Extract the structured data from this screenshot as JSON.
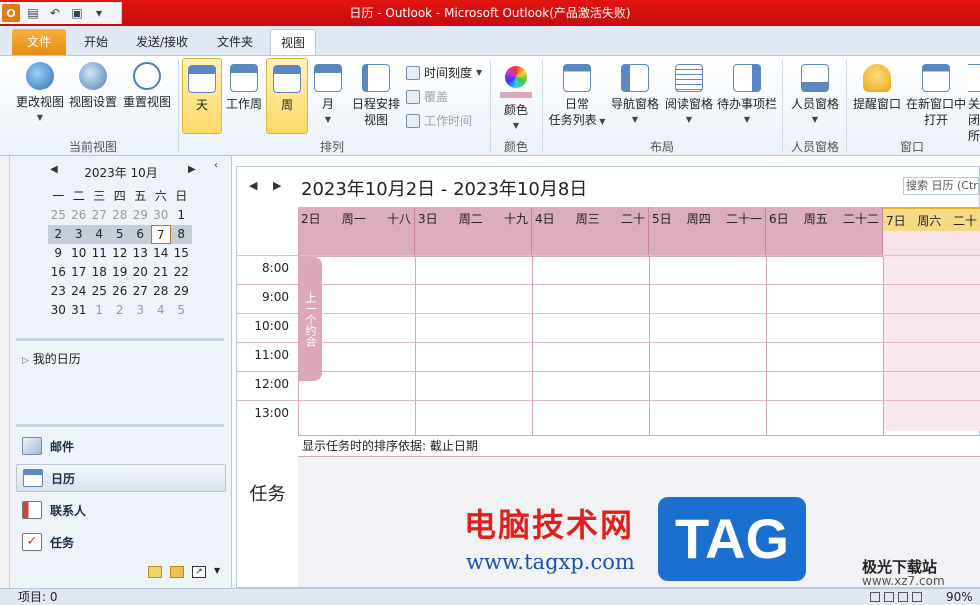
{
  "window": {
    "title": "日历 - Outlook - Microsoft Outlook(产品激活失败)"
  },
  "quick_access": [
    "outlook-app-icon",
    "save-icon",
    "undo-icon",
    "print-icon",
    "customize-icon"
  ],
  "tabs": [
    {
      "label": "文件"
    },
    {
      "label": "开始"
    },
    {
      "label": "发送/接收"
    },
    {
      "label": "文件夹"
    },
    {
      "label": "视图"
    }
  ],
  "ribbon": {
    "current_view": {
      "label": "当前视图",
      "change_view": "更改视图",
      "view_settings": "视图设置",
      "reset_view": "重置视图"
    },
    "arrange": {
      "label": "排列",
      "day": "天",
      "work_week": "工作周",
      "week": "周",
      "month": "月",
      "schedule_view_1": "日程安排",
      "schedule_view_2": "视图",
      "time_scale": "时间刻度",
      "overlay": "覆盖",
      "work_time": "工作时间"
    },
    "color": {
      "label": "颜色",
      "color_btn": "颜色"
    },
    "layout": {
      "label": "布局",
      "daily_task_1": "日常",
      "daily_task_2": "任务列表",
      "nav_pane": "导航窗格",
      "reading_pane": "阅读窗格",
      "todo_bar": "待办事项栏"
    },
    "people_pane": {
      "label": "人员窗格",
      "btn": "人员窗格"
    },
    "window": {
      "label": "窗口",
      "reminder": "提醒窗口",
      "new_window_1": "在新窗口中",
      "new_window_2": "打开",
      "close_all": "关闭所"
    }
  },
  "mini_calendar": {
    "month": "2023年 10月",
    "weekdays": [
      "一",
      "二",
      "三",
      "四",
      "五",
      "六",
      "日"
    ],
    "weeks": [
      [
        "25",
        "26",
        "27",
        "28",
        "29",
        "30",
        "1"
      ],
      [
        "2",
        "3",
        "4",
        "5",
        "6",
        "7",
        "8"
      ],
      [
        "9",
        "10",
        "11",
        "12",
        "13",
        "14",
        "15"
      ],
      [
        "16",
        "17",
        "18",
        "19",
        "20",
        "21",
        "22"
      ],
      [
        "23",
        "24",
        "25",
        "26",
        "27",
        "28",
        "29"
      ],
      [
        "30",
        "31",
        "1",
        "2",
        "3",
        "4",
        "5"
      ]
    ],
    "selected_week_index": 1,
    "today": "7"
  },
  "nav": {
    "my_calendars": "我的日历",
    "items": [
      {
        "label": "邮件"
      },
      {
        "label": "日历"
      },
      {
        "label": "联系人"
      },
      {
        "label": "任务"
      }
    ]
  },
  "calendar": {
    "range_title": "2023年10月2日 - 2023年10月8日",
    "search_placeholder": "搜索 日历 (Ctrl+E)",
    "days": [
      {
        "date": "2日",
        "weekday": "周一",
        "lunar": "十八"
      },
      {
        "date": "3日",
        "weekday": "周二",
        "lunar": "十九"
      },
      {
        "date": "4日",
        "weekday": "周三",
        "lunar": "二十"
      },
      {
        "date": "5日",
        "weekday": "周四",
        "lunar": "二十一"
      },
      {
        "date": "6日",
        "weekday": "周五",
        "lunar": "二十二"
      },
      {
        "date": "7日",
        "weekday": "周六",
        "lunar": "二十"
      }
    ],
    "times": [
      "8:00",
      "9:00",
      "10:00",
      "11:00",
      "12:00",
      "13:00"
    ],
    "prev_appointment": "上一个约会",
    "task_sort": "显示任务时的排序依据: 截止日期",
    "task_label": "任务"
  },
  "status": {
    "items": "项目: 0",
    "zoom": "90%"
  },
  "watermark": {
    "cn": "电脑技术网",
    "url": "www.tagxp.com",
    "tag": "TAG",
    "site": "极光下载站",
    "site_url": "www.xz7.com"
  },
  "colors": {
    "title_bar": "#d31010",
    "file_tab": "#f0a030",
    "day_header": "#dcadbd",
    "today_header": "#f6d985"
  }
}
